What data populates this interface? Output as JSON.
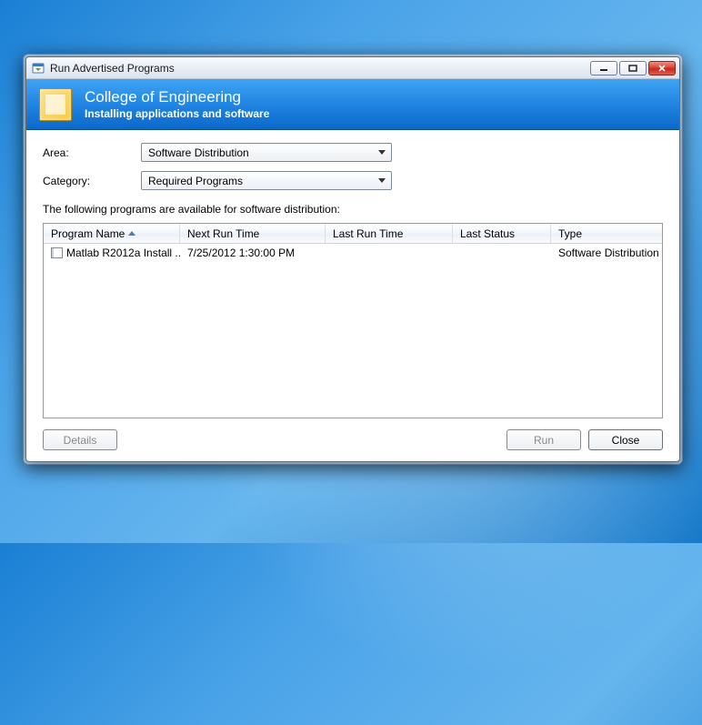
{
  "window": {
    "title": "Run Advertised Programs"
  },
  "banner": {
    "title": "College of Engineering",
    "subtitle": "Installing applications and software"
  },
  "form": {
    "area_label": "Area:",
    "area_value": "Software Distribution",
    "category_label": "Category:",
    "category_value": "Required Programs"
  },
  "caption": "The following programs are available for software distribution:",
  "columns": {
    "program_name": "Program Name",
    "next_run": "Next Run Time",
    "last_run": "Last Run Time",
    "last_status": "Last Status",
    "type": "Type"
  },
  "rows": [
    {
      "program_name": "Matlab R2012a Install ...",
      "next_run": "7/25/2012 1:30:00 PM",
      "last_run": "",
      "last_status": "",
      "type": "Software Distribution"
    }
  ],
  "buttons": {
    "details": "Details",
    "run": "Run",
    "close": "Close"
  }
}
